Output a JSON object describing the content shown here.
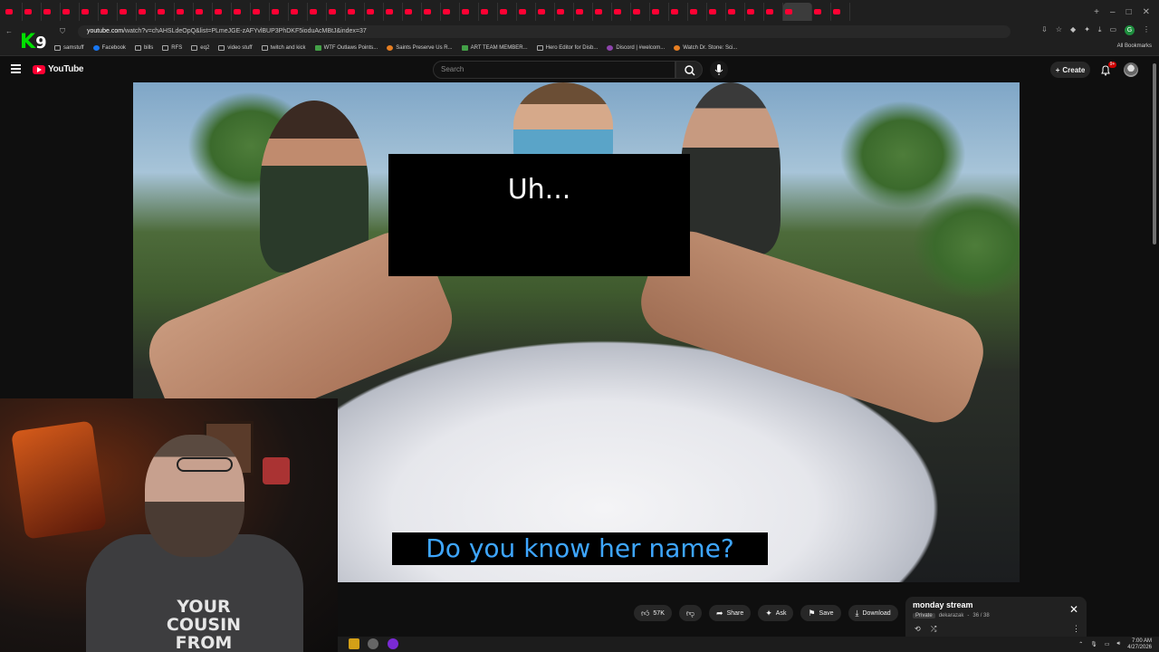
{
  "browser": {
    "tab_count": 44,
    "url_host": "youtube.com",
    "url_rest": "/watch?v=chAHSLdeOpQ&list=PLmeJGE-zAFYvlBUP3PhDKF5ioduAcMBtJ&index=37",
    "bookmarks": [
      {
        "label": "samstuff",
        "icon": "folder-icon"
      },
      {
        "label": "Facebook",
        "icon": "facebook-icon"
      },
      {
        "label": "bills",
        "icon": "folder-icon"
      },
      {
        "label": "RFS",
        "icon": "folder-icon"
      },
      {
        "label": "eq2",
        "icon": "folder-icon"
      },
      {
        "label": "video stuff",
        "icon": "folder-icon"
      },
      {
        "label": "twitch and kick",
        "icon": "folder-icon"
      },
      {
        "label": "WTF Outlaws Points...",
        "icon": "site-icon"
      },
      {
        "label": "Saints Preserve Us R...",
        "icon": "site-icon"
      },
      {
        "label": "ART TEAM MEMBER...",
        "icon": "site-icon"
      },
      {
        "label": "Hero Editor for Disb...",
        "icon": "folder-icon"
      },
      {
        "label": "Discord | #welcom...",
        "icon": "discord-icon"
      },
      {
        "label": "Watch Dr. Stone: Sci...",
        "icon": "site-icon"
      }
    ],
    "all_bookmarks": "All Bookmarks",
    "profile_initial": "G"
  },
  "overlay_logo": {
    "k": "K",
    "n": "9"
  },
  "youtube": {
    "brand": "YouTube",
    "search_placeholder": "Search",
    "create_label": "Create",
    "notif_badge": "9+"
  },
  "video": {
    "caption_top": "Uh...",
    "caption_bottom": "Do you know her name?"
  },
  "webcam": {
    "shirt_text": "YOUR COUSIN FROM"
  },
  "actions": {
    "like_count": "57K",
    "share": "Share",
    "ask": "Ask",
    "save": "Save",
    "download": "Download"
  },
  "playlist": {
    "title": "monday stream",
    "privacy": "Private",
    "owner": "dekarazak",
    "position": "36 / 38"
  },
  "taskbar": {
    "time": "7:00 AM",
    "date": "4/27/2026"
  }
}
